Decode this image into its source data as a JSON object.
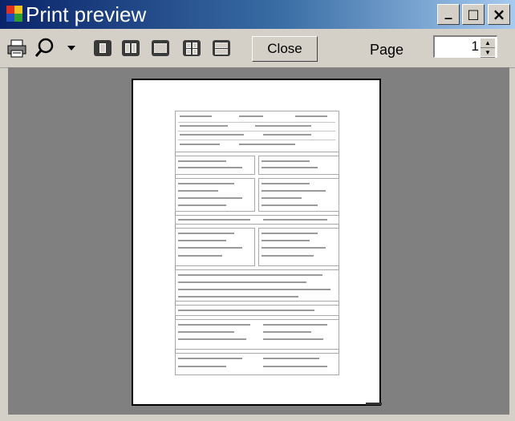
{
  "window": {
    "title": "Print preview",
    "controls": {
      "minimize": "_",
      "maximize": "□",
      "close": "×"
    }
  },
  "toolbar": {
    "print_icon": "printer-icon",
    "zoom_icon": "magnifier-icon",
    "zoom_dropdown_icon": "dropdown-arrow-icon",
    "layouts": [
      "one-page",
      "two-pages",
      "three-pages",
      "four-pages",
      "six-pages"
    ],
    "close_label": "Close",
    "page_label": "Page",
    "page_value": "1"
  },
  "colors": {
    "titlebar_start": "#0a246a",
    "titlebar_end": "#a6caf0",
    "workspace": "#808080",
    "chrome": "#d4d0c8"
  }
}
